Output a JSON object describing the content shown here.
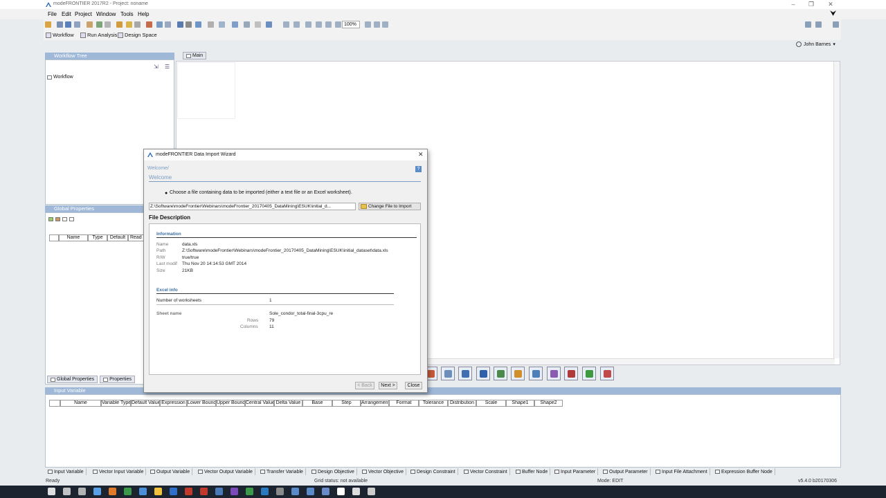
{
  "window": {
    "title": "modeFRONTIER 2017R2 - Project: noname"
  },
  "menu": [
    "File",
    "Edit",
    "Project",
    "Window",
    "Tools",
    "Help"
  ],
  "toolbar": {
    "zoom": "100%"
  },
  "modes": [
    "Workflow",
    "Run Analysis",
    "Design Space"
  ],
  "user": {
    "name": "John Barnes"
  },
  "workflow_tree": {
    "title": "Workflow Tree",
    "root": "Workflow"
  },
  "main_tab": "Main",
  "global_properties": {
    "title": "Global Properties",
    "columns": [
      "Name",
      "Type",
      "Default",
      "Read O"
    ],
    "tabs": [
      "Global Properties",
      "Properties"
    ]
  },
  "dialog": {
    "title": "modeFRONTIER Data Import Wizard",
    "breadcrumb": "Welcome/",
    "heading": "Welcome",
    "instruction": "Choose a file containing data to be imported (either a text file or an Excel worksheet).",
    "file_path": "Z:\\Software\\modeFrontier\\Webinars\\modeFrontier_20170405_DataMining\\ESUK\\initial_d...",
    "change_button": "Change File to Import",
    "file_description_title": "File Description",
    "information": {
      "title": "Information",
      "rows": [
        {
          "label": "Name",
          "value": "data.xls"
        },
        {
          "label": "Path",
          "value": "Z:\\Software\\modeFrontier\\Webinars\\modeFrontier_20170405_DataMining\\ESUK\\initial_dataset\\data.xls"
        },
        {
          "label": "R/W",
          "value": "true/true"
        },
        {
          "label": "Last modif",
          "value": "Thu Nov 20 14:14:53 GMT 2014"
        },
        {
          "label": "Size",
          "value": "21KB"
        }
      ]
    },
    "excel_info": {
      "title": "Excel info",
      "worksheets_label": "Number of worksheets",
      "worksheets_value": "1",
      "sheet_name_label": "Sheet name",
      "sheet_name_value": "Sole_condor_total-final-3cpu_re",
      "rows_label": "Rows",
      "rows_value": "79",
      "columns_label": "Columns",
      "columns_value": "11"
    },
    "buttons": {
      "back": "< Back",
      "next": "Next >",
      "close": "Close"
    }
  },
  "input_variable": {
    "title": "Input Variable",
    "columns": [
      "Name",
      "Variable Type",
      "Default Value",
      "Expression",
      "Lower Bound",
      "Upper Bound",
      "Central Value",
      "Delta Value",
      "Base",
      "Step",
      "Arrangement",
      "Format",
      "Tolerance",
      "Distribution",
      "Scale",
      "Shape1",
      "Shape2"
    ]
  },
  "node_tabs": [
    "Input Variable",
    "Vector Input Variable",
    "Output Variable",
    "Vector Output Variable",
    "Transfer Variable",
    "Design Objective",
    "Vector Objective",
    "Design Constraint",
    "Vector Constraint",
    "Buffer Node",
    "Input Parameter",
    "Output Parameter",
    "Input File Attachment",
    "Expression Buffer Node"
  ],
  "status": {
    "left": "Ready",
    "grid": "Grid status: not available",
    "mode": "Mode: EDIT",
    "version": "v5.4.0 b20170306"
  },
  "colors": {
    "panel_header": "#9fb8d8",
    "accent": "#3a6ea5",
    "taskbar": "#1c2430"
  }
}
